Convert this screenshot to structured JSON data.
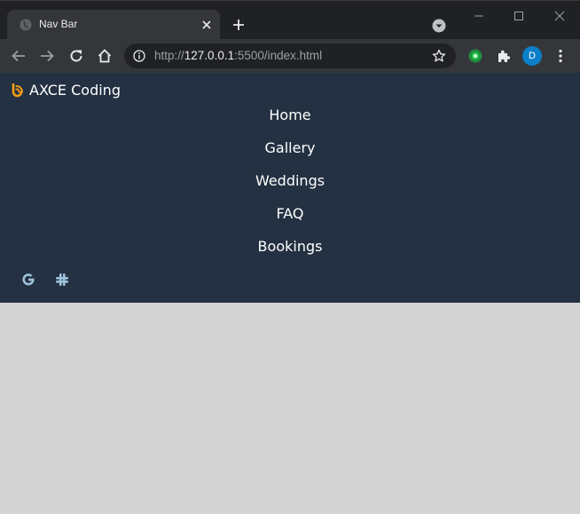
{
  "browser": {
    "tab_title": "Nav Bar",
    "url_scheme": "http://",
    "url_host": "127.0.0.1",
    "url_rest": ":5500/index.html",
    "profile_initial": "D"
  },
  "page": {
    "brand_text": "AXCE Coding",
    "nav_links": [
      "Home",
      "Gallery",
      "Weddings",
      "FAQ",
      "Bookings"
    ],
    "social_icons": [
      "google-icon",
      "slack-icon"
    ]
  },
  "colors": {
    "navbar_bg": "#233142",
    "page_bg": "#d3d3d3",
    "brand_icon": "#f39c12",
    "social_icon": "#9fc2dd"
  }
}
